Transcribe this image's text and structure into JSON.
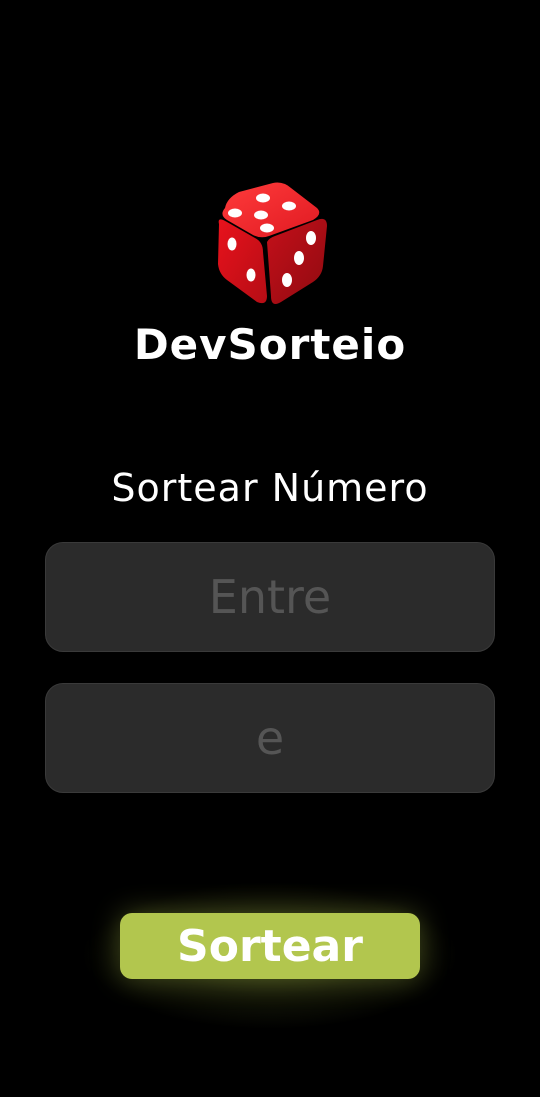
{
  "brand": {
    "icon": "dice-icon",
    "title": "DevSorteio",
    "dice_color": "#e31b23",
    "pip_color": "#ffffff"
  },
  "form": {
    "heading": "Sortear Número",
    "min_input": {
      "placeholder": "Entre",
      "value": ""
    },
    "max_input": {
      "placeholder": "e",
      "value": ""
    }
  },
  "actions": {
    "draw_label": "Sortear",
    "button_color": "#b2c64e"
  }
}
